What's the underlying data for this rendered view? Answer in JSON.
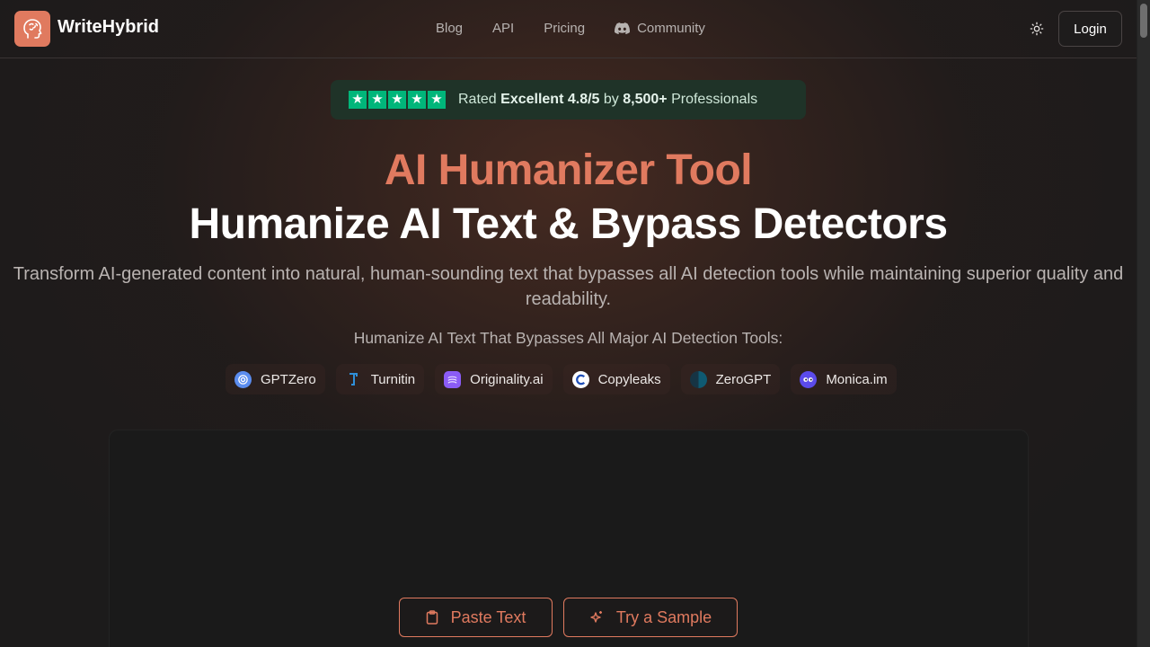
{
  "header": {
    "brand": "WriteHybrid",
    "nav": [
      {
        "label": "Blog"
      },
      {
        "label": "API"
      },
      {
        "label": "Pricing"
      },
      {
        "label": "Community",
        "icon": "discord-icon"
      }
    ],
    "login_label": "Login"
  },
  "rating": {
    "prefix": "Rated ",
    "excellent": "Excellent 4.8/5",
    "by": " by ",
    "count": "8,500+",
    "suffix": " Professionals",
    "star_color": "#00b67a"
  },
  "hero": {
    "title_accent": "AI Humanizer Tool",
    "title_main": "Humanize AI Text & Bypass Detectors",
    "subtitle": "Transform AI-generated content into natural, human-sounding text that bypasses all AI detection tools while maintaining superior quality and readability.",
    "tools_heading": "Humanize AI Text That Bypasses All Major AI Detection Tools:",
    "accent_color": "#e07a5f"
  },
  "tools": [
    {
      "name": "GPTZero",
      "icon": "gptzero-icon"
    },
    {
      "name": "Turnitin",
      "icon": "turnitin-icon"
    },
    {
      "name": "Originality.ai",
      "icon": "originality-icon"
    },
    {
      "name": "Copyleaks",
      "icon": "copyleaks-icon"
    },
    {
      "name": "ZeroGPT",
      "icon": "zerogpt-icon"
    },
    {
      "name": "Monica.im",
      "icon": "monica-icon"
    }
  ],
  "actions": {
    "paste_label": "Paste Text",
    "sample_label": "Try a Sample"
  }
}
